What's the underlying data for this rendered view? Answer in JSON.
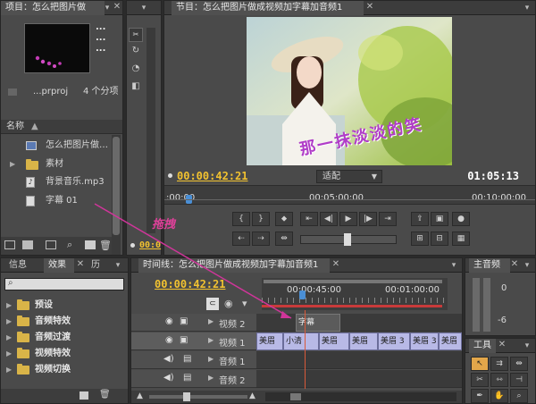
{
  "project": {
    "tab_title": "项目：怎么把图片做",
    "thumb_info_lines": [
      "...",
      "...",
      "..."
    ],
    "file_name": "...prproj",
    "item_count": "4 个分项",
    "column_name": "名称",
    "items": [
      {
        "label": "怎么把图片做…",
        "icon": "sequence-icon"
      },
      {
        "label": "素材",
        "icon": "folder-icon"
      },
      {
        "label": "背景音乐.mp3",
        "icon": "audio-file-icon"
      },
      {
        "label": "字幕 01",
        "icon": "title-file-icon"
      }
    ]
  },
  "source": {
    "timecode": "00:0"
  },
  "program": {
    "tab_title": "节目：怎么把图片做成视频加字幕加音频1",
    "overlay_text": "那一抹淡淡的笑",
    "current_tc": "00:00:42:21",
    "fit_label": "适配",
    "duration_tc": "01:05:13",
    "ruler_marks": [
      ":00:00",
      "00:05:00:00",
      "00:10:00:00"
    ]
  },
  "annotation": {
    "drag_label": "拖拽"
  },
  "effects": {
    "tabs": [
      "信息",
      "效果",
      "历"
    ],
    "search_placeholder": "",
    "items": [
      "预设",
      "音频特效",
      "音频过渡",
      "视频特效",
      "视频切换"
    ]
  },
  "timeline": {
    "tab_title": "时间线：怎么把图片做成视频加字幕加音频1",
    "current_tc": "00:00:42:21",
    "ruler_marks": [
      "00:00:45:00",
      "00:01:00:00"
    ],
    "tracks": [
      {
        "name": "视频 2",
        "type": "video"
      },
      {
        "name": "视频 1",
        "type": "video"
      },
      {
        "name": "音频 1",
        "type": "audio"
      },
      {
        "name": "音频 2",
        "type": "audio"
      }
    ],
    "v2_clip": "字幕",
    "v1_clips": [
      "美眉",
      "小清",
      "美眉",
      "美眉",
      "美眉 3",
      "美眉 3",
      "美眉"
    ]
  },
  "audio_master": {
    "tab_title": "主音频",
    "scale": [
      "0",
      "-6"
    ]
  },
  "tools": {
    "tab_title": "工具"
  },
  "colors": {
    "timecode": "#f2c230",
    "overlay_text": "#b03cc8",
    "clip": "#b8b9e6",
    "drag_line": "#d0359a",
    "playhead": "#d95a3a"
  }
}
